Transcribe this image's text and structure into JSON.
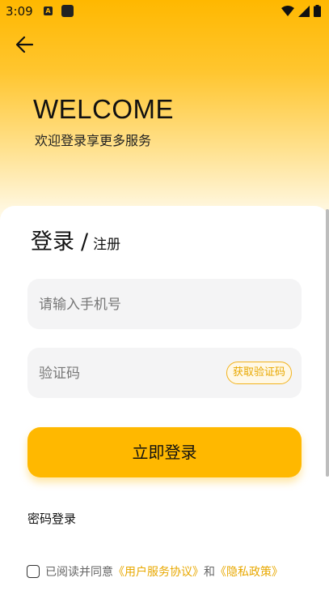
{
  "status_bar": {
    "time": "3:09",
    "notification_icon": "A",
    "app_icon": "app-icon",
    "right_icons": [
      "wifi-icon",
      "signal-icon",
      "battery-icon"
    ]
  },
  "header": {
    "back_icon": "back-arrow-icon",
    "welcome_title": "WELCOME",
    "welcome_subtitle": "欢迎登录享更多服务"
  },
  "tabs": {
    "login": "登录",
    "separator": "/",
    "register": "注册"
  },
  "form": {
    "phone_placeholder": "请输入手机号",
    "phone_value": "",
    "code_placeholder": "验证码",
    "code_value": "",
    "get_code_label": "获取验证码",
    "submit_label": "立即登录"
  },
  "password_login_label": "密码登录",
  "agreement": {
    "checked": false,
    "prefix": "已阅读并同意",
    "user_agreement": "《用户服务协议》",
    "conjunction": "和",
    "privacy_policy": "《隐私政策》"
  },
  "colors": {
    "accent": "#ffb800",
    "link": "#e8a800",
    "field_bg": "#f4f4f5"
  }
}
